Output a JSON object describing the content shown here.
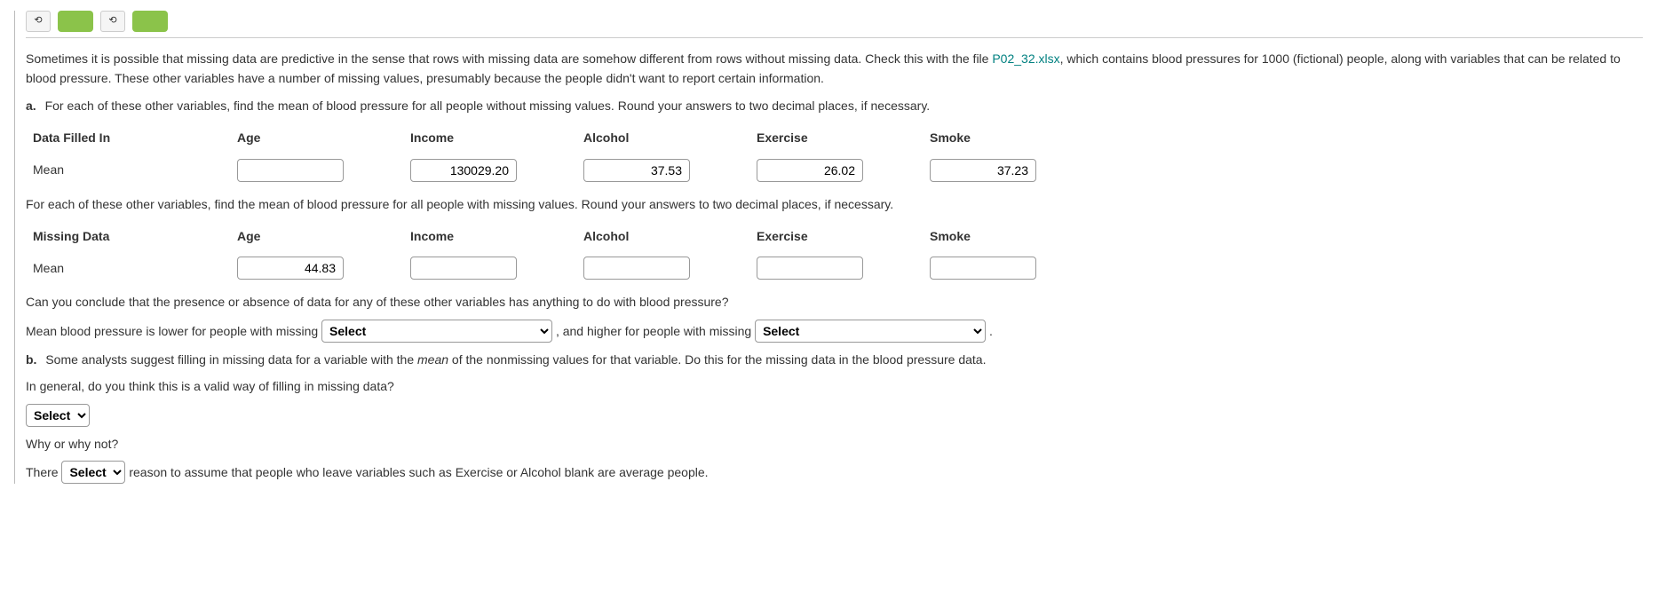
{
  "topbar": {
    "btn1": " ",
    "btn2": " "
  },
  "intro": {
    "text_before_link": "Sometimes it is possible that missing data are predictive in the sense that rows with missing data are somehow different from rows without missing data. Check this with the file ",
    "file_link": "P02_32.xlsx",
    "text_after_link": ", which contains blood pressures for 1000 (fictional) people, along with variables that can be related to blood pressure. These other variables have a number of missing values, presumably because the people didn't want to report certain information."
  },
  "partA": {
    "letter": "a.",
    "prompt": "For each of these other variables, find the mean of blood pressure for all people without missing values. Round your answers to two decimal places, if necessary.",
    "filled": {
      "header": "Data Filled In",
      "cols": {
        "age": "Age",
        "income": "Income",
        "alcohol": "Alcohol",
        "exercise": "Exercise",
        "smoke": "Smoke"
      },
      "row_label": "Mean",
      "values": {
        "age": "",
        "income": "130029.20",
        "alcohol": "37.53",
        "exercise": "26.02",
        "smoke": "37.23"
      }
    },
    "prompt2": "For each of these other variables, find the mean of blood pressure for all people with missing values. Round your answers to two decimal places, if necessary.",
    "missing": {
      "header": "Missing Data",
      "cols": {
        "age": "Age",
        "income": "Income",
        "alcohol": "Alcohol",
        "exercise": "Exercise",
        "smoke": "Smoke"
      },
      "row_label": "Mean",
      "values": {
        "age": "44.83",
        "income": "",
        "alcohol": "",
        "exercise": "",
        "smoke": ""
      }
    },
    "conclusion_q": "Can you conclude that the presence or absence of data for any of these other variables has anything to do with blood pressure?",
    "sentence": {
      "s1": "Mean blood pressure is lower for people with missing ",
      "select1": "Select",
      "s2": " , and higher for people with missing ",
      "select2": "Select",
      "s3": " ."
    }
  },
  "partB": {
    "letter": "b.",
    "prompt_before_italic": "Some analysts suggest filling in missing data for a variable with the ",
    "italic_word": "mean",
    "prompt_after_italic": " of the nonmissing values for that variable. Do this for the missing data in the blood pressure data.",
    "valid_q": "In general, do you think this is a valid way of filling in missing data?",
    "select_valid": "Select",
    "why": "Why or why not?",
    "there_sentence": {
      "s1": "There ",
      "select": "Select",
      "s2": " reason to assume that people who leave variables such as Exercise or Alcohol blank are average people."
    }
  }
}
